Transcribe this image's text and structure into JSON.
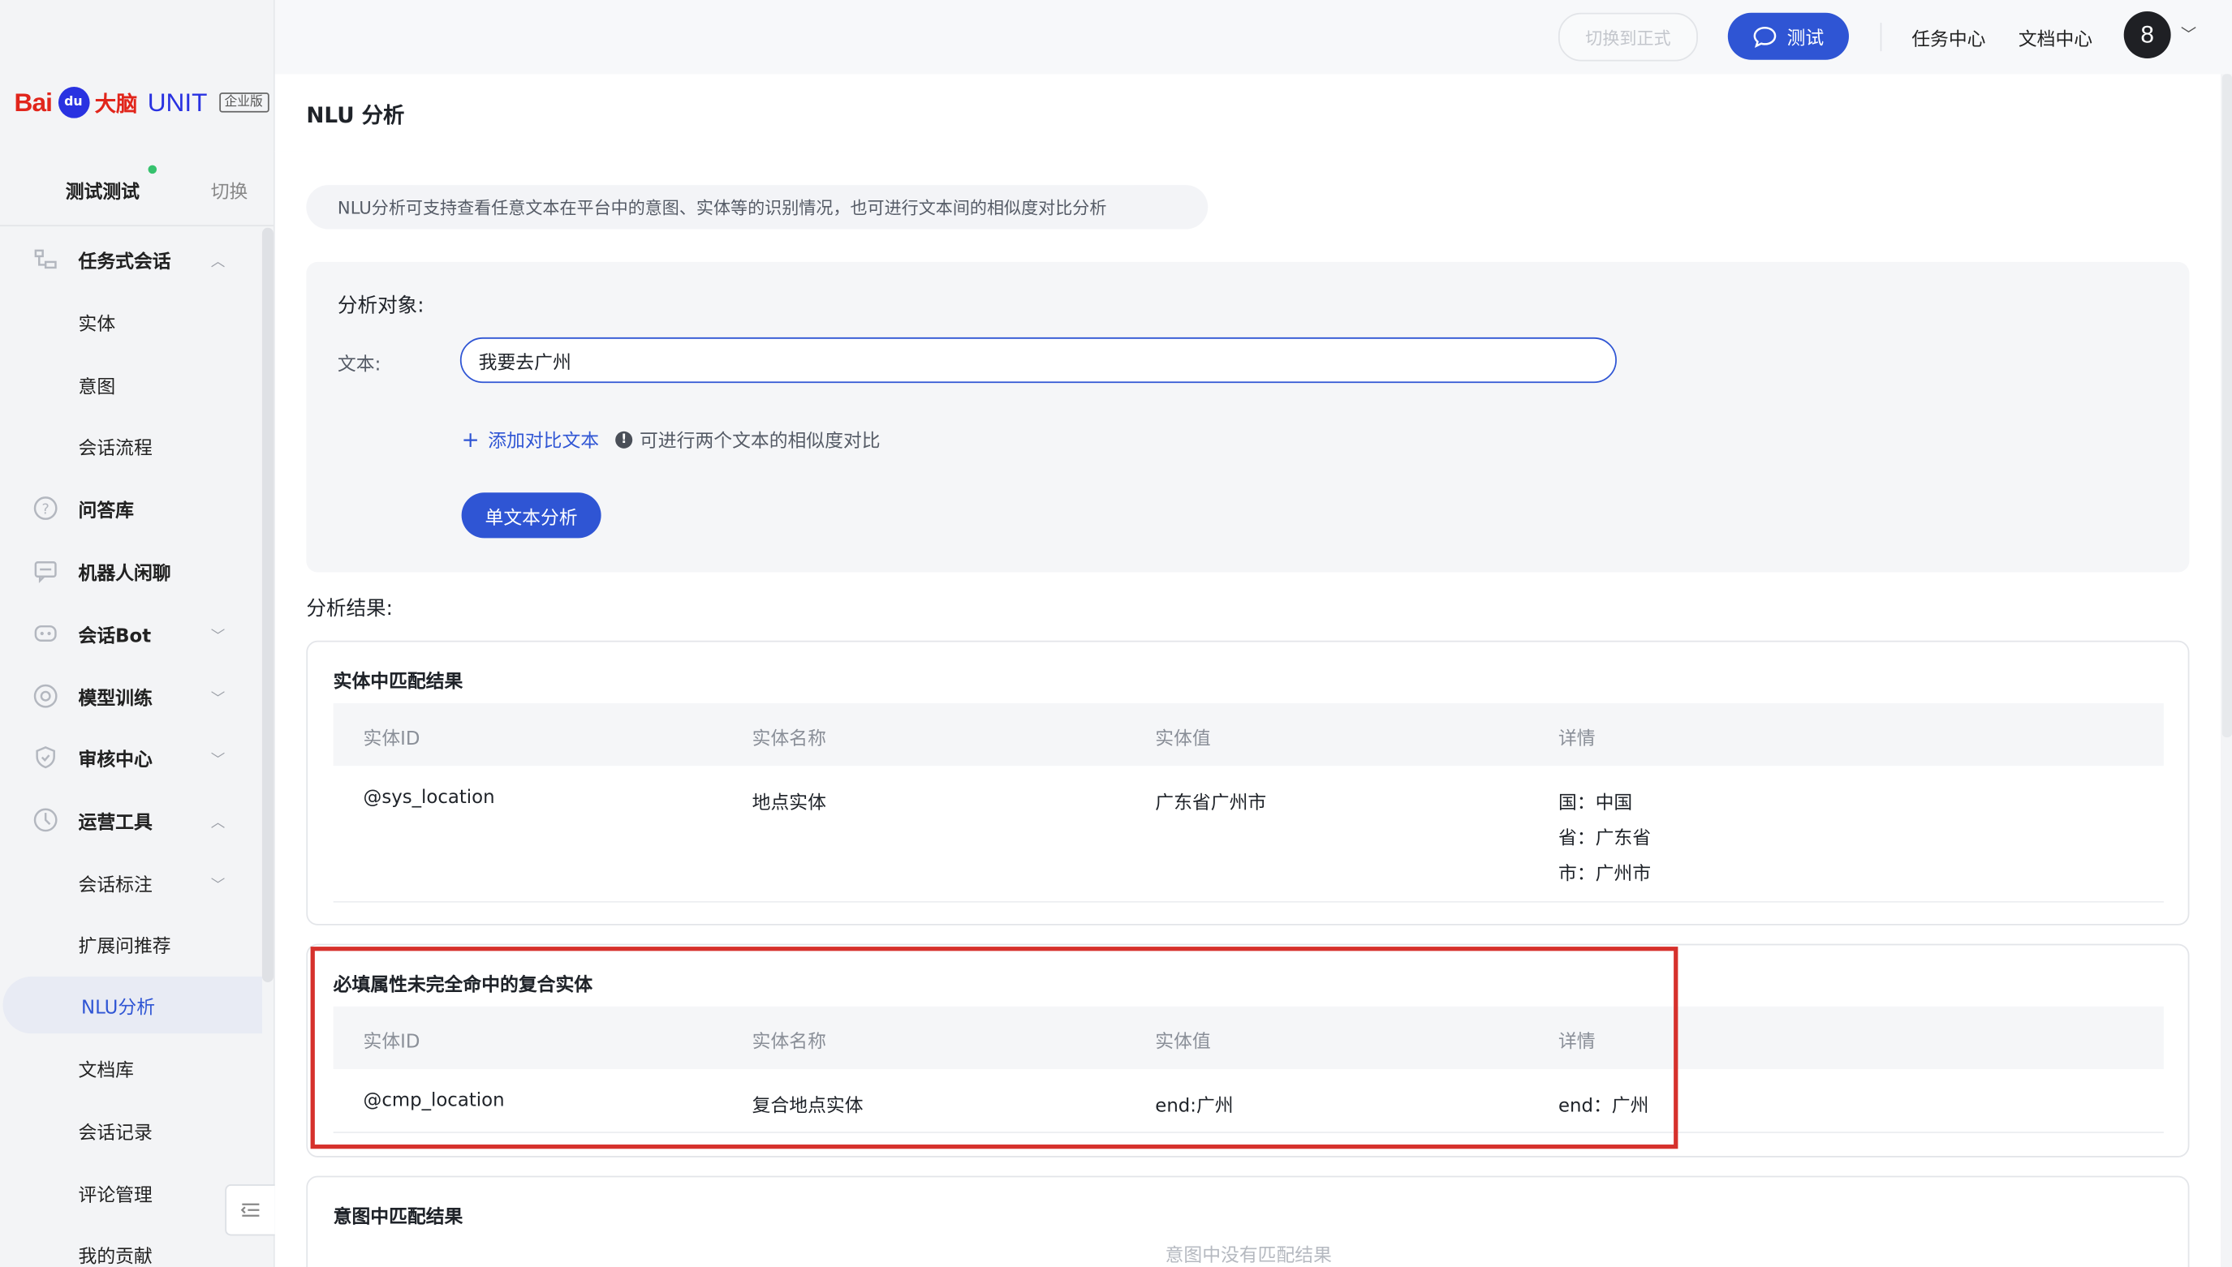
{
  "brand": {
    "logo_bai": "Bai",
    "logo_du": "du",
    "logo_cn": "大脑",
    "logo_unit": "UNIT",
    "logo_badge": "企业版"
  },
  "workspace": {
    "name": "测试测试",
    "switch_label": "切换"
  },
  "sidebar": {
    "items": [
      {
        "label": "任务式会话",
        "icon": "task-dialog-icon",
        "caret": "up",
        "group": true
      },
      {
        "label": "实体",
        "group": false
      },
      {
        "label": "意图",
        "group": false
      },
      {
        "label": "会话流程",
        "group": false
      },
      {
        "label": "问答库",
        "icon": "qa-icon",
        "group": true
      },
      {
        "label": "机器人闲聊",
        "icon": "chat-icon",
        "group": true
      },
      {
        "label": "会话Bot",
        "icon": "bot-icon",
        "caret": "down",
        "group": true
      },
      {
        "label": "模型训练",
        "icon": "train-icon",
        "caret": "down",
        "group": true
      },
      {
        "label": "审核中心",
        "icon": "shield-icon",
        "caret": "down",
        "group": true
      },
      {
        "label": "运营工具",
        "icon": "tools-icon",
        "caret": "up",
        "group": true
      },
      {
        "label": "会话标注",
        "caret": "down",
        "group": false
      },
      {
        "label": "扩展问推荐",
        "group": false
      },
      {
        "label": "NLU分析",
        "group": false,
        "active": true
      },
      {
        "label": "文档库",
        "group": false
      },
      {
        "label": "会话记录",
        "group": false
      },
      {
        "label": "评论管理",
        "group": false
      },
      {
        "label": "我的贡献",
        "group": false
      }
    ]
  },
  "topbar": {
    "switch_formal": "切换到正式",
    "test_button": "测试",
    "task_center": "任务中心",
    "doc_center": "文档中心",
    "avatar_text": "8"
  },
  "page": {
    "title": "NLU 分析",
    "info": "NLU分析可支持查看任意文本在平台中的意图、实体等的识别情况，也可进行文本间的相似度对比分析",
    "analysis_target_title": "分析对象:",
    "text_label": "文本:",
    "text_value": "我要去广州",
    "add_compare": "添加对比文本",
    "compare_hint": "可进行两个文本的相似度对比",
    "analyze_button": "单文本分析",
    "result_title": "分析结果:"
  },
  "results": {
    "entity_match": {
      "title": "实体中匹配结果",
      "columns": [
        "实体ID",
        "实体名称",
        "实体值",
        "详情"
      ],
      "rows": [
        {
          "id": "@sys_location",
          "name": "地点实体",
          "value": "广东省广州市",
          "details": [
            "国：中国",
            "省：广东省",
            "市：广州市"
          ]
        }
      ]
    },
    "composite_match": {
      "title": "必填属性未完全命中的复合实体",
      "columns": [
        "实体ID",
        "实体名称",
        "实体值",
        "详情"
      ],
      "rows": [
        {
          "id": "@cmp_location",
          "name": "复合地点实体",
          "value": "end:广州",
          "details": [
            "end：广州"
          ]
        }
      ]
    },
    "intent_match": {
      "title": "意图中匹配结果",
      "empty": "意图中没有匹配结果"
    }
  },
  "colors": {
    "accent": "#2f55d4",
    "highlight_border": "#d6312c",
    "status_dot": "#36c26e"
  }
}
